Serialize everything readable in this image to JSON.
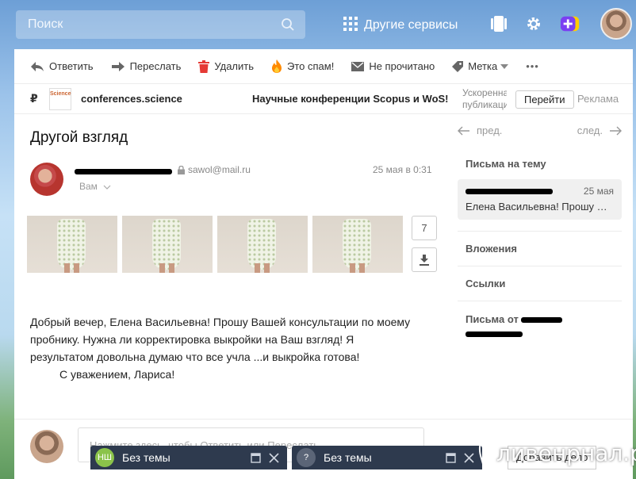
{
  "topbar": {
    "search_placeholder": "Поиск",
    "services_label": "Другие сервисы"
  },
  "toolbar": {
    "reply": "Ответить",
    "forward": "Переслать",
    "delete": "Удалить",
    "spam": "Это спам!",
    "unread": "Не прочитано",
    "label": "Метка",
    "more": "•••"
  },
  "ad": {
    "currency": "₽",
    "logo_text": "Science",
    "domain": "conferences.science",
    "title": "Научные конференции Scopus и WoS!",
    "desc": "Ускоренная публикация",
    "go": "Перейти",
    "label": "Реклама"
  },
  "message": {
    "subject": "Другой взгляд",
    "sender_email": "sawol@mail.ru",
    "to": "Вам",
    "date": "25 мая в 0:31",
    "attachments_count": "7",
    "body_lines": [
      "Добрый вечер, Елена Васильевна! Прошу Вашей консультации по моему пробнику. Нужна ли корректировка выкройки на Ваш взгляд! Я результатом довольна думаю что все учла ...и выкройка готова!"
    ],
    "signature": "С уважением, Лариса!"
  },
  "reply": {
    "placeholder": "Нажмите здесь, чтобы Ответить или Переслать"
  },
  "sidebar": {
    "prev": "пред.",
    "next": "след.",
    "thread_title": "Письма на тему",
    "thread_date": "25 мая",
    "thread_snippet": "Елена Васильевна! Прошу Вашей консультации",
    "attachments": "Вложения",
    "links": "Ссылки",
    "from_title": "Письма от"
  },
  "compose": [
    {
      "badge": "НШ",
      "title": "Без темы",
      "color": "#8bc34a"
    },
    {
      "badge": "?",
      "title": "Без темы",
      "color": "#5b6577"
    }
  ],
  "send_button": "Добавить дело",
  "watermark": "ливенрнал.ру",
  "colors": {
    "accent": "#2e3a4e",
    "delete_red": "#e53935",
    "spam_orange": "#ff8a00"
  }
}
